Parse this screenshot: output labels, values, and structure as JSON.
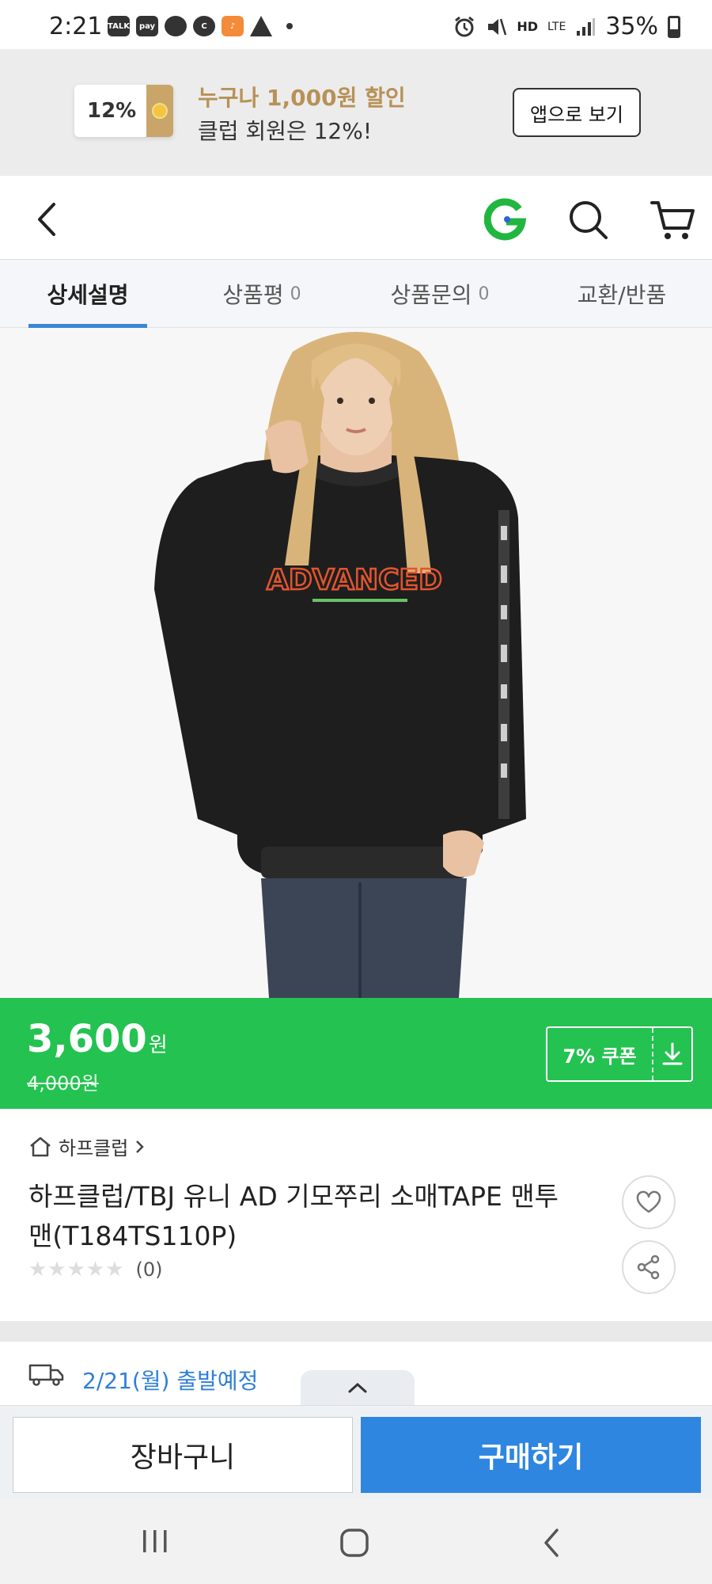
{
  "status_bar": {
    "time": "2:21",
    "notif_icons": [
      "talk-icon",
      "pay-icon",
      "chat-bubble-icon",
      "c-icon",
      "tiktok-icon",
      "warning-icon",
      "dot-icon"
    ],
    "notif_labels": [
      "TALK",
      "pay",
      "",
      "C",
      "♪"
    ],
    "right_icons": [
      "alarm-icon",
      "mute-icon",
      "hd-voice-icon",
      "lte-icon",
      "signal-icon",
      "battery-icon"
    ],
    "hd": "HD",
    "lte": "LTE",
    "battery": "35%"
  },
  "promo": {
    "badge": "12%",
    "line1": "누구나 1,000원 할인",
    "line2": "클럽 회원은 12%!",
    "button": "앱으로 보기",
    "accent_color": "#b89157"
  },
  "nav": {
    "icons": [
      "back-icon",
      "gmarket-logo-icon",
      "search-icon",
      "cart-icon"
    ]
  },
  "tabs": [
    {
      "label": "상세설명",
      "count": "",
      "active": true
    },
    {
      "label": "상품평",
      "count": "0",
      "active": false
    },
    {
      "label": "상품문의",
      "count": "0",
      "active": false
    },
    {
      "label": "교환/반품",
      "count": "",
      "active": false
    }
  ],
  "product_image": {
    "print_text": "ADVANCED"
  },
  "price": {
    "current": "3,600",
    "unit": "원",
    "original": "4,000원",
    "coupon": "7% 쿠폰",
    "bar_color": "#24c250"
  },
  "info": {
    "store": "하프클럽",
    "title": "하프클럽/TBJ 유니 AD 기모쭈리 소매TAPE 맨투맨(T184TS110P)",
    "stars": "★★★★★",
    "review_count": "(0)"
  },
  "shipping": {
    "text": "2/21(월) 출발예정",
    "color": "#2e7fd9"
  },
  "actions": {
    "cart": "장바구니",
    "buy": "구매하기",
    "buy_color": "#2f86e0"
  }
}
